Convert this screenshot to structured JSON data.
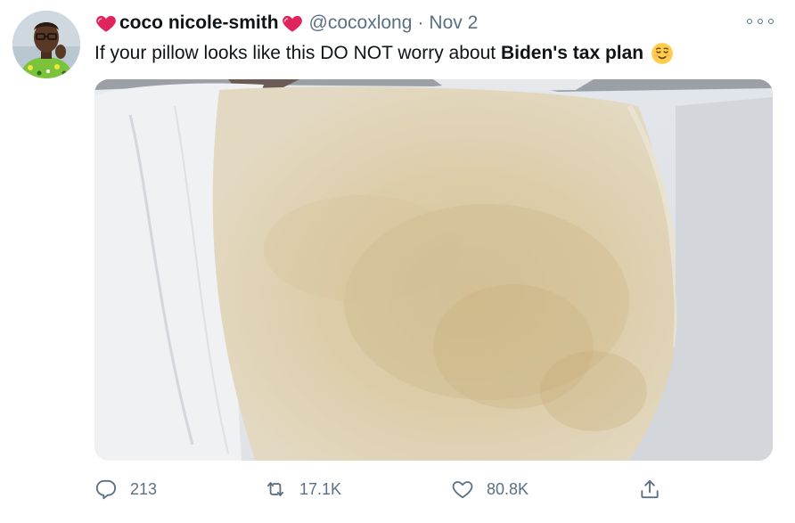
{
  "tweet": {
    "display_name": "coco nicole-smith",
    "handle": "@cocoxlong",
    "separator": "·",
    "date": "Nov 2",
    "text_before": "If your pillow looks like this DO NOT worry about ",
    "text_bold": "Biden's tax plan",
    "emoji": "relieved-face-emoji",
    "name_decoration": "heart-icon",
    "media_alt": "photo of a heavily stained yellowed pillow on a bed"
  },
  "actions": {
    "replies": "213",
    "retweets": "17.1K",
    "likes": "80.8K"
  },
  "colors": {
    "text_primary": "#0f1419",
    "text_secondary": "#5b7083",
    "heart": "#e0245e"
  }
}
